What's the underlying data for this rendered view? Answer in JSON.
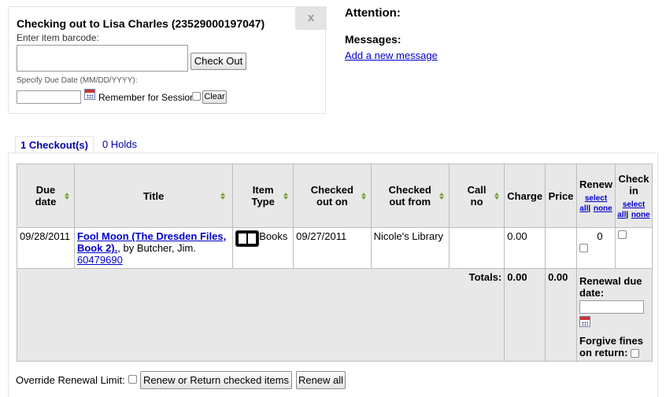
{
  "checkout": {
    "title": "Checking out to Lisa Charles (23529000197047)",
    "barcode_label": "Enter item barcode:",
    "barcode_value": "",
    "checkout_button": "Check Out",
    "due_label": "Specify Due Date (MM/DD/YYYY):",
    "due_value": "",
    "remember_label": "Remember for Session:",
    "clear_button": "Clear",
    "close_label": "x"
  },
  "attention": {
    "title": "Attention:",
    "messages_title": "Messages:",
    "add_message_link": "Add a new message"
  },
  "tabs": [
    {
      "label": "1 Checkout(s)"
    },
    {
      "label": "0 Holds"
    }
  ],
  "table": {
    "headers": {
      "due_date": "Due date",
      "title": "Title",
      "item_type": "Item Type",
      "checked_out_on": "Checked out on",
      "checked_out_from": "Checked out from",
      "call_no": "Call no",
      "charge": "Charge",
      "price": "Price",
      "renew": "Renew",
      "check_in": "Check in",
      "select_all": "select all",
      "none": "none"
    },
    "rows": [
      {
        "due_date": "09/28/2011",
        "title_link": "Fool Moon (The Dresden Files, Book 2).",
        "author": ", by Butcher, Jim.",
        "barcode": "60479690",
        "item_type": "Books",
        "checked_out_on": "09/27/2011",
        "checked_out_from": "Nicole's Library",
        "call_no": "",
        "charge": "0.00",
        "price": "",
        "renew_count": "0"
      }
    ],
    "totals": {
      "label": "Totals:",
      "charge": "0.00",
      "price": "0.00",
      "renewal_due_label": "Renewal due date:",
      "forgive_label": "Forgive fines on return:"
    }
  },
  "footer": {
    "override_label": "Override Renewal Limit:",
    "renew_return_button": "Renew or Return checked items",
    "renew_all_button": "Renew all"
  }
}
